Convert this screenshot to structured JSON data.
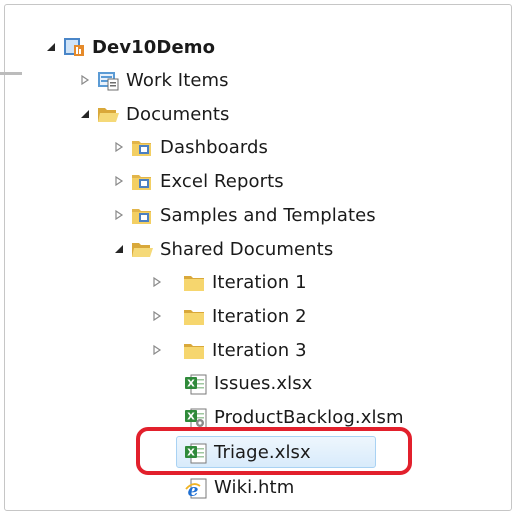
{
  "tree": {
    "root": {
      "label": "Dev10Demo",
      "icon": "team-project-icon",
      "expanded": true
    },
    "work_items": {
      "label": "Work Items",
      "icon": "work-items-icon"
    },
    "documents": {
      "label": "Documents",
      "icon": "folder-open-icon",
      "expanded": true
    },
    "dashboards": {
      "label": "Dashboards",
      "icon": "sharepoint-library-icon"
    },
    "excel_reports": {
      "label": "Excel Reports",
      "icon": "sharepoint-library-icon"
    },
    "samples": {
      "label": "Samples and Templates",
      "icon": "sharepoint-library-icon"
    },
    "shared_documents": {
      "label": "Shared Documents",
      "icon": "folder-open-icon",
      "expanded": true
    },
    "iteration1": {
      "label": "Iteration 1",
      "icon": "folder-icon"
    },
    "iteration2": {
      "label": "Iteration 2",
      "icon": "folder-icon"
    },
    "iteration3": {
      "label": "Iteration 3",
      "icon": "folder-icon"
    },
    "issues": {
      "label": "Issues.xlsx",
      "icon": "excel-file-icon"
    },
    "product_backlog": {
      "label": "ProductBacklog.xlsm",
      "icon": "excel-macro-file-icon"
    },
    "triage": {
      "label": "Triage.xlsx",
      "icon": "excel-file-icon",
      "selected": true,
      "highlighted": true
    },
    "wiki": {
      "label": "Wiki.htm",
      "icon": "ie-html-file-icon"
    }
  },
  "colors": {
    "highlight_ring": "#e2202c",
    "selection_border": "#a9d2f3",
    "folder": "#f3cf63",
    "excel_green": "#2f8a3a"
  }
}
